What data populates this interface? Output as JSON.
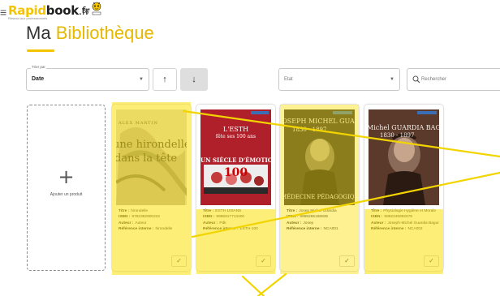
{
  "header": {
    "menu_icon": "hamburger-icon",
    "logo": {
      "part1": "Rapid",
      "part2": "book",
      "part3": ".fr",
      "by": "By",
      "tagline": "Réseau aux professionnels"
    },
    "title_prefix": "Ma ",
    "title_accent": "Bibliothèque"
  },
  "toolbar": {
    "sort_legend": "Trier par",
    "sort_value": "Date",
    "sort_up_icon": "↑",
    "sort_down_icon": "↓",
    "state_placeholder": "Etat",
    "search_placeholder": "Rechercher"
  },
  "add_card": {
    "plus": "+",
    "label": "Ajouter un produit"
  },
  "labels": {
    "title": "Titre :",
    "isbn": "ISBN :",
    "author": "Auteur :",
    "ref": "Référence interne :"
  },
  "products": [
    {
      "title": "hirondelle",
      "isbn": "9782382900222",
      "author": "Auteur",
      "ref": "hirondelle",
      "cover_line1": "une hirondelle",
      "cover_line2": "dans la tête",
      "cover_author": "ALEX MARTIN"
    },
    {
      "title": "ESTH 100ANS",
      "isbn": "9995917713400",
      "author": "Pdk",
      "ref": "ESTH-100",
      "cover_line1": "L'ESTH",
      "cover_line2": "fête ses 100 ans",
      "cover_line3": "UN SIÈCLE D'ÉMOTIONS",
      "cover_year": "100"
    },
    {
      "title": "Josep Michel Guardia",
      "isbn": "9998265188836",
      "author": "Josep",
      "ref": "NCA001",
      "cover_line1": "JOSEPH MICHEL GUARDIA",
      "cover_line2": "1830 - 1897",
      "cover_line3": "MÉDECINE PÉDAGOGIQUE"
    },
    {
      "title": "Physiologie Hygiène et Morale",
      "isbn": "9992245892676",
      "author": "Joseph-Michel Guardia Bagur",
      "ref": "NCA002",
      "cover_line1": "Michel GUARDIA BAGUR",
      "cover_line2": "1830 - 1897"
    }
  ],
  "colors": {
    "accent": "#f4c400",
    "highlight": "#fce00a"
  }
}
